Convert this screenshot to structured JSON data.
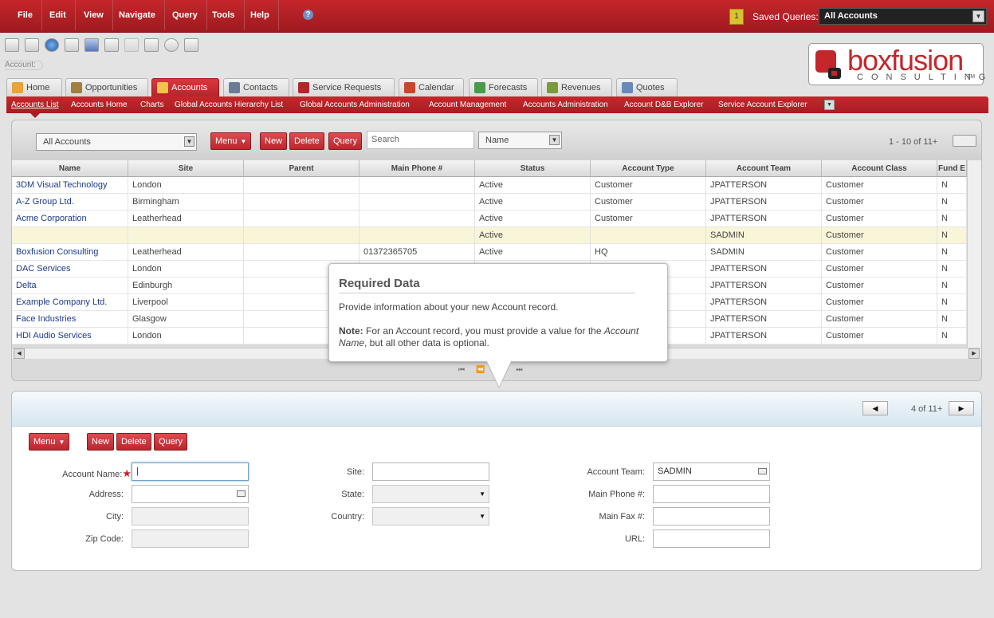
{
  "menu": [
    "File",
    "Edit",
    "View",
    "Navigate",
    "Query",
    "Tools",
    "Help"
  ],
  "help_icon": "?",
  "saved_queries": {
    "badge": "1",
    "label": "Saved Queries:",
    "value": "All Accounts"
  },
  "breadcrumb": "Account:",
  "logo": {
    "name": "boxfusion",
    "sub": "CONSULTING",
    "tm": "TM"
  },
  "tabs": [
    "Home",
    "Opportunities",
    "Accounts",
    "Contacts",
    "Service Requests",
    "Calendar",
    "Forecasts",
    "Revenues",
    "Quotes"
  ],
  "subnav": [
    "Accounts List",
    "Accounts Home",
    "Charts",
    "Global Accounts Hierarchy List",
    "Global Accounts Administration",
    "Account Management",
    "Accounts Administration",
    "Account D&B Explorer",
    "Service Account Explorer"
  ],
  "list": {
    "query_select": "All Accounts",
    "menu_label": "Menu",
    "new_label": "New",
    "delete_label": "Delete",
    "query_label": "Query",
    "search_placeholder": "Search",
    "field_select": "Name",
    "count": "1 - 10 of 11+",
    "columns": [
      "Name",
      "Site",
      "Parent",
      "Main Phone #",
      "Status",
      "Account Type",
      "Account Team",
      "Account Class",
      "Fund E"
    ],
    "rows": [
      [
        "3DM Visual Technology",
        "London",
        "",
        "",
        "Active",
        "Customer",
        "JPATTERSON",
        "Customer",
        "N"
      ],
      [
        "A-Z Group Ltd.",
        "Birmingham",
        "",
        "",
        "Active",
        "Customer",
        "JPATTERSON",
        "Customer",
        "N"
      ],
      [
        "Acme Corporation",
        "Leatherhead",
        "",
        "",
        "Active",
        "Customer",
        "JPATTERSON",
        "Customer",
        "N"
      ],
      [
        "",
        "",
        "",
        "",
        "Active",
        "",
        "SADMIN",
        "Customer",
        "N"
      ],
      [
        "Boxfusion Consulting",
        "Leatherhead",
        "",
        "01372365705",
        "Active",
        "HQ",
        "SADMIN",
        "Customer",
        "N"
      ],
      [
        "DAC Services",
        "London",
        "",
        "",
        "",
        "",
        "JPATTERSON",
        "Customer",
        "N"
      ],
      [
        "Delta",
        "Edinburgh",
        "",
        "",
        "",
        "",
        "JPATTERSON",
        "Customer",
        "N"
      ],
      [
        "Example Company Ltd.",
        "Liverpool",
        "",
        "",
        "",
        "",
        "JPATTERSON",
        "Customer",
        "N"
      ],
      [
        "Face Industries",
        "Glasgow",
        "",
        "",
        "",
        "",
        "JPATTERSON",
        "Customer",
        "N"
      ],
      [
        "HDI Audio Services",
        "London",
        "",
        "",
        "",
        "",
        "JPATTERSON",
        "Customer",
        "N"
      ]
    ]
  },
  "form": {
    "count": "4 of 11+",
    "menu_label": "Menu",
    "new_label": "New",
    "delete_label": "Delete",
    "query_label": "Query",
    "labels": {
      "account_name": "Account Name:",
      "address": "Address:",
      "city": "City:",
      "zip": "Zip Code:",
      "site": "Site:",
      "state": "State:",
      "country": "Country:",
      "account_team": "Account Team:",
      "main_phone": "Main Phone #:",
      "main_fax": "Main Fax #:",
      "url": "URL:"
    },
    "values": {
      "account_team": "SADMIN"
    },
    "required_mark": "★"
  },
  "tooltip": {
    "title": "Required Data",
    "body": "Provide information about your new Account record.",
    "note_label": "Note:",
    "note_text_1": " For an Account record, you must provide a value for the ",
    "note_em_1": "Account Name",
    "note_text_2": ", but all other data is optional."
  }
}
